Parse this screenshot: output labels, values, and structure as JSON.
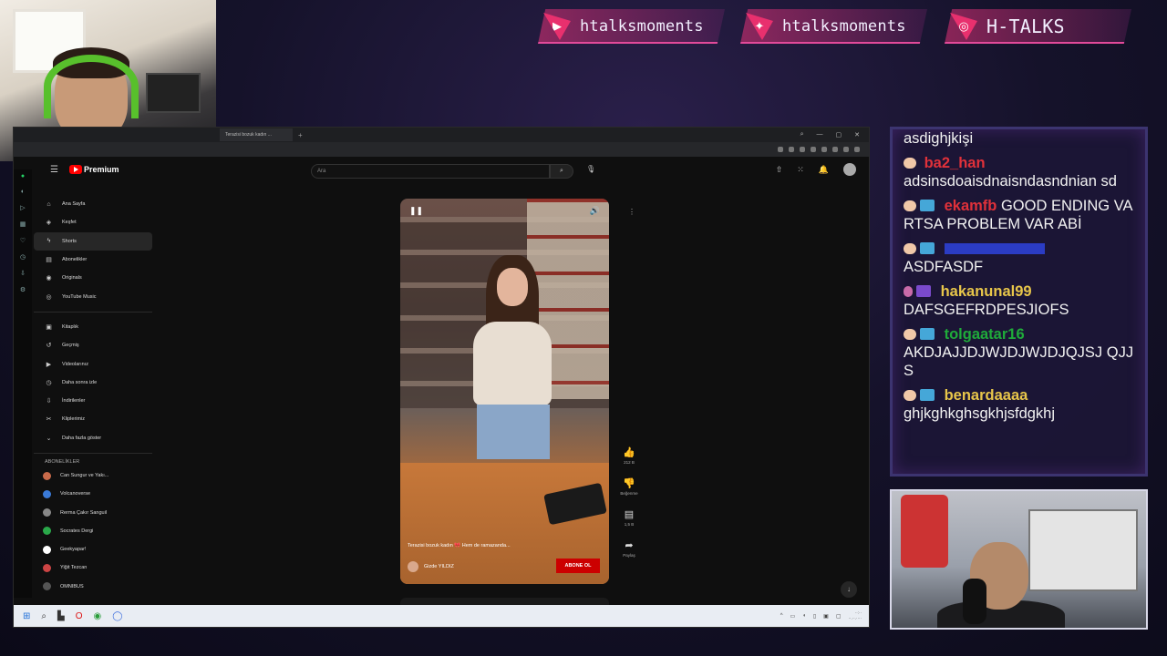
{
  "overlay": {
    "socials": [
      {
        "icon": "youtube-icon",
        "handle": "htalksmoments",
        "glyph": "▶"
      },
      {
        "icon": "twitter-icon",
        "handle": "htalksmoments",
        "glyph": "✦"
      },
      {
        "icon": "instagram-icon",
        "handle": "H-TALKS",
        "glyph": "◎"
      }
    ],
    "accent_color": "#e8306e"
  },
  "chat": {
    "messages": [
      {
        "user": "",
        "user_color": "#ffffff",
        "badges": [],
        "text": "asdighjkişi"
      },
      {
        "user": "ba2_han",
        "user_color": "#e0313a",
        "badges": [
          "emote"
        ],
        "text": "adsinsdoaisdnaisndasndnian sd"
      },
      {
        "user": "ekamfb",
        "user_color": "#e0313a",
        "badges": [
          "emote",
          "sub"
        ],
        "text": "GOOD ENDING VARTSA PROBLEM VAR ABİ"
      },
      {
        "user": "",
        "user_color": "#2b3cc4",
        "badges": [
          "emote",
          "sub"
        ],
        "text": "ASDFASDF"
      },
      {
        "user": "hakanunal99",
        "user_color": "#e8c64a",
        "badges": [
          "mod",
          "sub2"
        ],
        "text": "DAFSGEFRDPESJIOFS"
      },
      {
        "user": "tolgaatar16",
        "user_color": "#1faa3a",
        "badges": [
          "emote",
          "sub"
        ],
        "text": "AKDJAJJDJWJDJWJDJQJSJ QJJS"
      },
      {
        "user": "benardaaaa",
        "user_color": "#e8c64a",
        "badges": [
          "emote",
          "sub"
        ],
        "text": "ghjkghkghsgkhjsfdgkhj"
      }
    ]
  },
  "browser": {
    "tab_title": "Terazisi bozuk kadın ...",
    "youtube": {
      "logo_text": "Premium",
      "search_placeholder": "Ara",
      "sidebar_main": [
        {
          "icon": "home-icon",
          "glyph": "⌂",
          "label": "Ana Sayfa",
          "active": false
        },
        {
          "icon": "explore-icon",
          "glyph": "◈",
          "label": "Keşfet",
          "active": false
        },
        {
          "icon": "shorts-icon",
          "glyph": "ϟ",
          "label": "Shorts",
          "active": true
        },
        {
          "icon": "subscriptions-icon",
          "glyph": "▤",
          "label": "Abonelikler",
          "active": false
        },
        {
          "icon": "originals-icon",
          "glyph": "◉",
          "label": "Originals",
          "active": false
        },
        {
          "icon": "youtube-music-icon",
          "glyph": "◎",
          "label": "YouTube Music",
          "active": false
        }
      ],
      "sidebar_library": [
        {
          "icon": "library-icon",
          "glyph": "▣",
          "label": "Kitaplık"
        },
        {
          "icon": "history-icon",
          "glyph": "↺",
          "label": "Geçmiş"
        },
        {
          "icon": "your-videos-icon",
          "glyph": "▶",
          "label": "Videolarınız"
        },
        {
          "icon": "watch-later-icon",
          "glyph": "◷",
          "label": "Daha sonra izle"
        },
        {
          "icon": "downloads-icon",
          "glyph": "⇩",
          "label": "İndirilenler"
        },
        {
          "icon": "clips-icon",
          "glyph": "✂",
          "label": "Kliplerimiz"
        },
        {
          "icon": "show-more-icon",
          "glyph": "⌄",
          "label": "Daha fazla göster"
        }
      ],
      "subscriptions_header": "ABONELİKLER",
      "subscriptions": [
        {
          "name": "Can Sungur ve Yakı...",
          "color": "#c86a4a"
        },
        {
          "name": "Volcanoverse",
          "color": "#3a7ad8"
        },
        {
          "name": "Rerma Çakır Sanguil",
          "color": "#888888"
        },
        {
          "name": "Socrates Dergi",
          "color": "#2aa84a"
        },
        {
          "name": "Geekyapar!",
          "color": "#ffffff"
        },
        {
          "name": "Yiğit Tezcan",
          "color": "#c44"
        },
        {
          "name": "OMNIBUS",
          "color": "#555555"
        }
      ],
      "short": {
        "caption": "Terazisi bozuk kadın 🎀 Hem de ramazanda...",
        "channel": "Gizde YILDIZ",
        "subscribe_label": "ABONE OL",
        "like_count": "212 B",
        "dislike_label": "Beğenme",
        "comment_count": "1,5 B",
        "share_label": "Paylaş"
      }
    }
  }
}
